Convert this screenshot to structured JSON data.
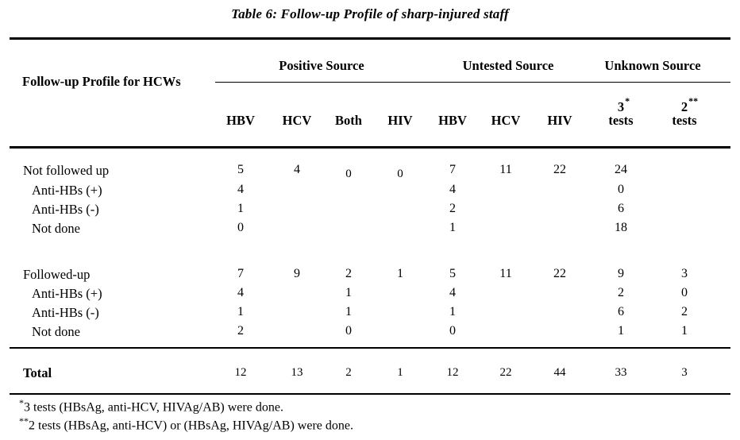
{
  "title": "Table 6:  Follow-up Profile of sharp-injured staff",
  "header": {
    "stub": "Follow-up Profile for HCWs",
    "groups": [
      {
        "label": "Positive Source"
      },
      {
        "label": "Untested Source"
      },
      {
        "label": "Unknown Source"
      }
    ],
    "columns": [
      {
        "label": "HBV",
        "sup": ""
      },
      {
        "label": "HCV",
        "sup": ""
      },
      {
        "label": "Both",
        "sup": ""
      },
      {
        "label": "HIV",
        "sup": ""
      },
      {
        "label": "HBV",
        "sup": ""
      },
      {
        "label": "HCV",
        "sup": ""
      },
      {
        "label": "HIV",
        "sup": ""
      },
      {
        "label": "tests",
        "num": "3",
        "sup": "*"
      },
      {
        "label": "tests",
        "num": "2",
        "sup": "**"
      }
    ]
  },
  "body": {
    "block1": {
      "rows": [
        {
          "label": "Not followed up",
          "indent": false,
          "values": [
            "5",
            "4",
            "0",
            "0",
            "7",
            "11",
            "22",
            "24",
            ""
          ]
        },
        {
          "label": "Anti-HBs (+)",
          "indent": true,
          "values": [
            "4",
            "",
            "",
            "",
            "4",
            "",
            "",
            "0",
            ""
          ]
        },
        {
          "label": "Anti-HBs (-)",
          "indent": true,
          "values": [
            "1",
            "",
            "",
            "",
            "2",
            "",
            "",
            "6",
            ""
          ]
        },
        {
          "label": "Not done",
          "indent": true,
          "values": [
            "0",
            "",
            "",
            "",
            "1",
            "",
            "",
            "18",
            ""
          ]
        }
      ]
    },
    "block2": {
      "rows": [
        {
          "label": "Followed-up",
          "indent": false,
          "values": [
            "7",
            "9",
            "2",
            "1",
            "5",
            "11",
            "22",
            "9",
            "3"
          ]
        },
        {
          "label": "Anti-HBs (+)",
          "indent": true,
          "values": [
            "4",
            "",
            "1",
            "",
            "4",
            "",
            "",
            "2",
            "0"
          ]
        },
        {
          "label": "Anti-HBs (-)",
          "indent": true,
          "values": [
            "1",
            "",
            "1",
            "",
            "1",
            "",
            "",
            "6",
            "2"
          ]
        },
        {
          "label": "Not done",
          "indent": true,
          "values": [
            "2",
            "",
            "0",
            "",
            "0",
            "",
            "",
            "1",
            "1"
          ]
        }
      ]
    },
    "total": {
      "label": "Total",
      "values": [
        "12",
        "13",
        "2",
        "1",
        "12",
        "22",
        "44",
        "33",
        "3"
      ]
    }
  },
  "footnotes": [
    {
      "mark": "*",
      "text": "3 tests (HBsAg, anti-HCV, HIVAg/AB) were done."
    },
    {
      "mark": "**",
      "text": "2 tests (HBsAg, anti-HCV) or (HBsAg, HIVAg/AB) were done."
    }
  ]
}
